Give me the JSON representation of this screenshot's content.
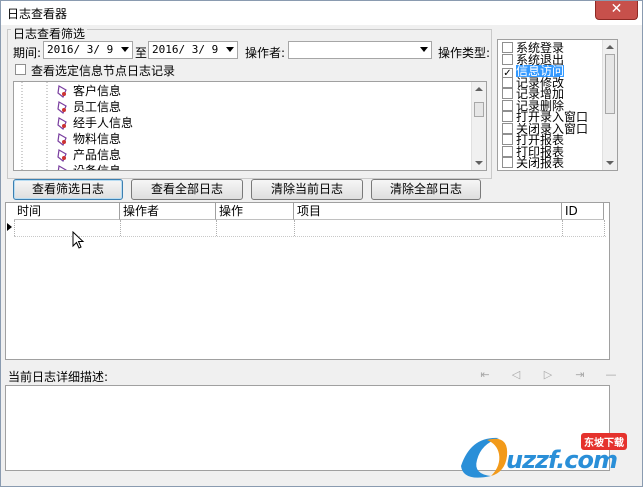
{
  "window": {
    "title": "日志查看器",
    "close_label": "✕"
  },
  "filter": {
    "group_title": "日志查看筛选",
    "period_label": "期间:",
    "start_date": "2016/ 3/ 9",
    "to_label": "至",
    "end_date": "2016/ 3/ 9",
    "operator_label": "操作者:",
    "operator_value": "",
    "optype_label": "操作类型:",
    "view_selected_node_label": "查看选定信息节点日志记录"
  },
  "tree": {
    "items": [
      "客户信息",
      "员工信息",
      "经手人信息",
      "物料信息",
      "产品信息",
      "设备信息"
    ]
  },
  "op_types": [
    {
      "label": "系统登录",
      "checked": false
    },
    {
      "label": "系统退出",
      "checked": false
    },
    {
      "label": "信息访问",
      "checked": true,
      "selected": true
    },
    {
      "label": "记录修改",
      "checked": false
    },
    {
      "label": "记录增加",
      "checked": false
    },
    {
      "label": "记录删除",
      "checked": false
    },
    {
      "label": "打开录入窗口",
      "checked": false
    },
    {
      "label": "关闭录入窗口",
      "checked": false
    },
    {
      "label": "打开报表",
      "checked": false
    },
    {
      "label": "打印报表",
      "checked": false
    },
    {
      "label": "关闭报表",
      "checked": false
    }
  ],
  "buttons": {
    "view_filtered": "查看筛选日志",
    "view_all": "查看全部日志",
    "clear_current": "清除当前日志",
    "clear_all": "清除全部日志"
  },
  "table": {
    "columns": [
      "时间",
      "操作者",
      "操作",
      "项目",
      "ID"
    ]
  },
  "detail": {
    "label": "当前日志详细描述:",
    "nav": {
      "first": "⇤",
      "prev": "◁",
      "next": "▷",
      "last": "⇥",
      "end": "—"
    }
  },
  "watermark": {
    "brand": "uzzf.com",
    "badge": "东坡下载"
  },
  "colors": {
    "accent": "#3399ff",
    "close": "#c7504b",
    "brand": "#2a8fd8"
  }
}
